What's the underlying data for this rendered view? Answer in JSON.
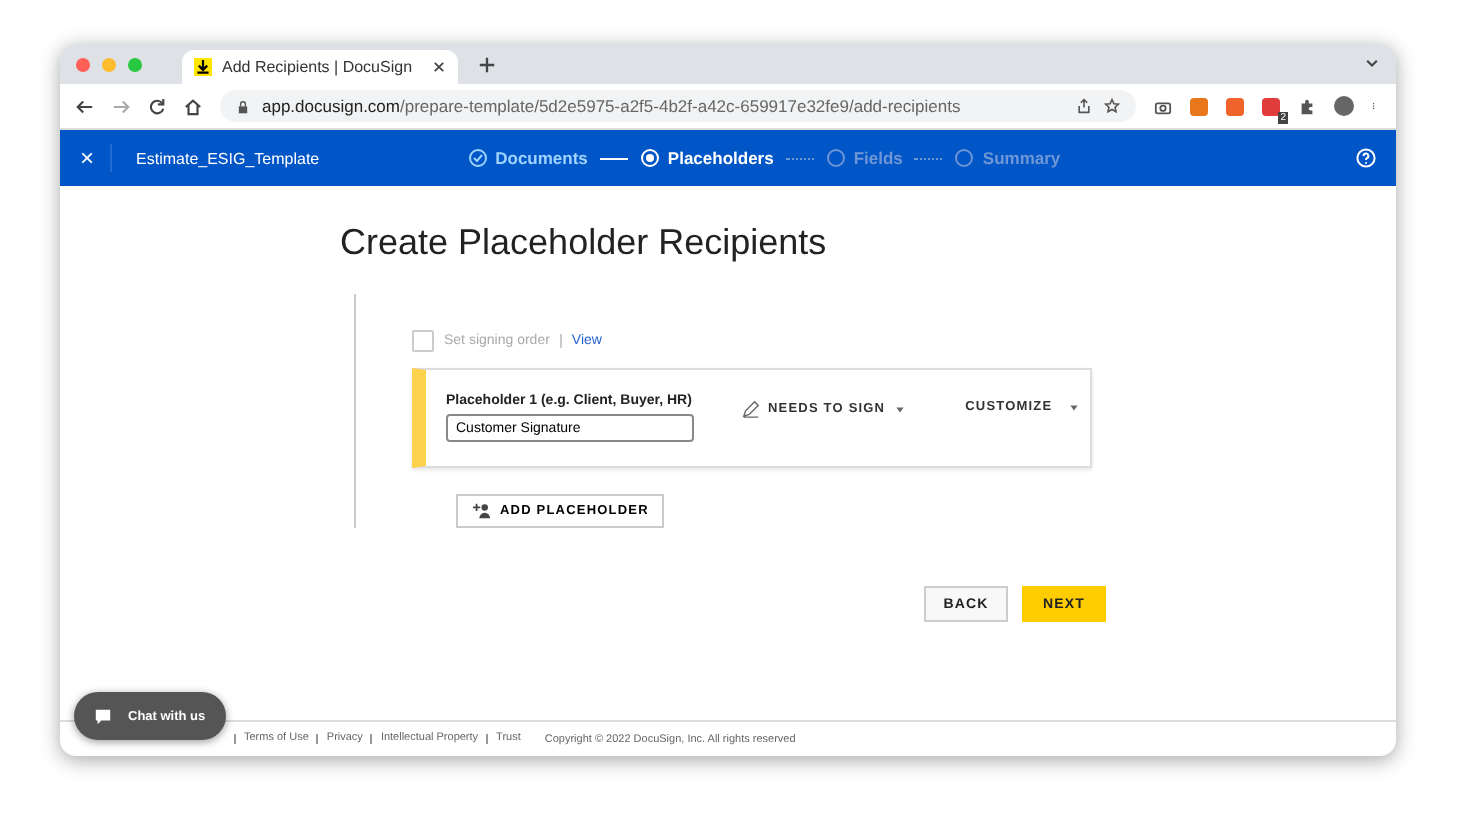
{
  "browser": {
    "tab": {
      "title": "Add Recipients | DocuSign"
    },
    "url": {
      "host": "app.docusign.com",
      "path": "/prepare-template/5d2e5975-a2f5-4b2f-a42c-659917e32fe9/add-recipients"
    },
    "extensions": [
      {
        "color": "#e8761b"
      },
      {
        "color": "#f0642b"
      },
      {
        "color": "#e23b3b",
        "badge": "2"
      }
    ]
  },
  "header": {
    "close": "×",
    "template_name": "Estimate_ESIG_Template",
    "steps": [
      {
        "label": "Documents",
        "completed": true,
        "selected": false
      },
      {
        "label": "Placeholders",
        "completed": false,
        "selected": true
      },
      {
        "label": "Fields",
        "completed": false,
        "selected": false
      },
      {
        "label": "Summary",
        "completed": false,
        "selected": false
      }
    ]
  },
  "page": {
    "title": "Create Placeholder Recipients",
    "signing_order": {
      "label": "Set signing order",
      "checked": false,
      "link": "View"
    },
    "placeholders": [
      {
        "label": "Placeholder 1 (e.g. Client, Buyer, HR)",
        "value": "Customer Signature",
        "action": "NEEDS TO SIGN",
        "customize": "CUSTOMIZE",
        "color": "#fdd34e"
      }
    ],
    "add_button": "ADD PLACEHOLDER",
    "buttons": [
      {
        "label": "BACK",
        "kind": "secondary"
      },
      {
        "label": "NEXT",
        "kind": "primary"
      }
    ]
  },
  "chat": {
    "label": "Chat with us"
  },
  "footer": {
    "links": [
      "Terms of Use",
      "Privacy",
      "Intellectual Property",
      "Trust"
    ],
    "copyright": "Copyright © 2022 DocuSign, Inc. All rights reserved"
  }
}
